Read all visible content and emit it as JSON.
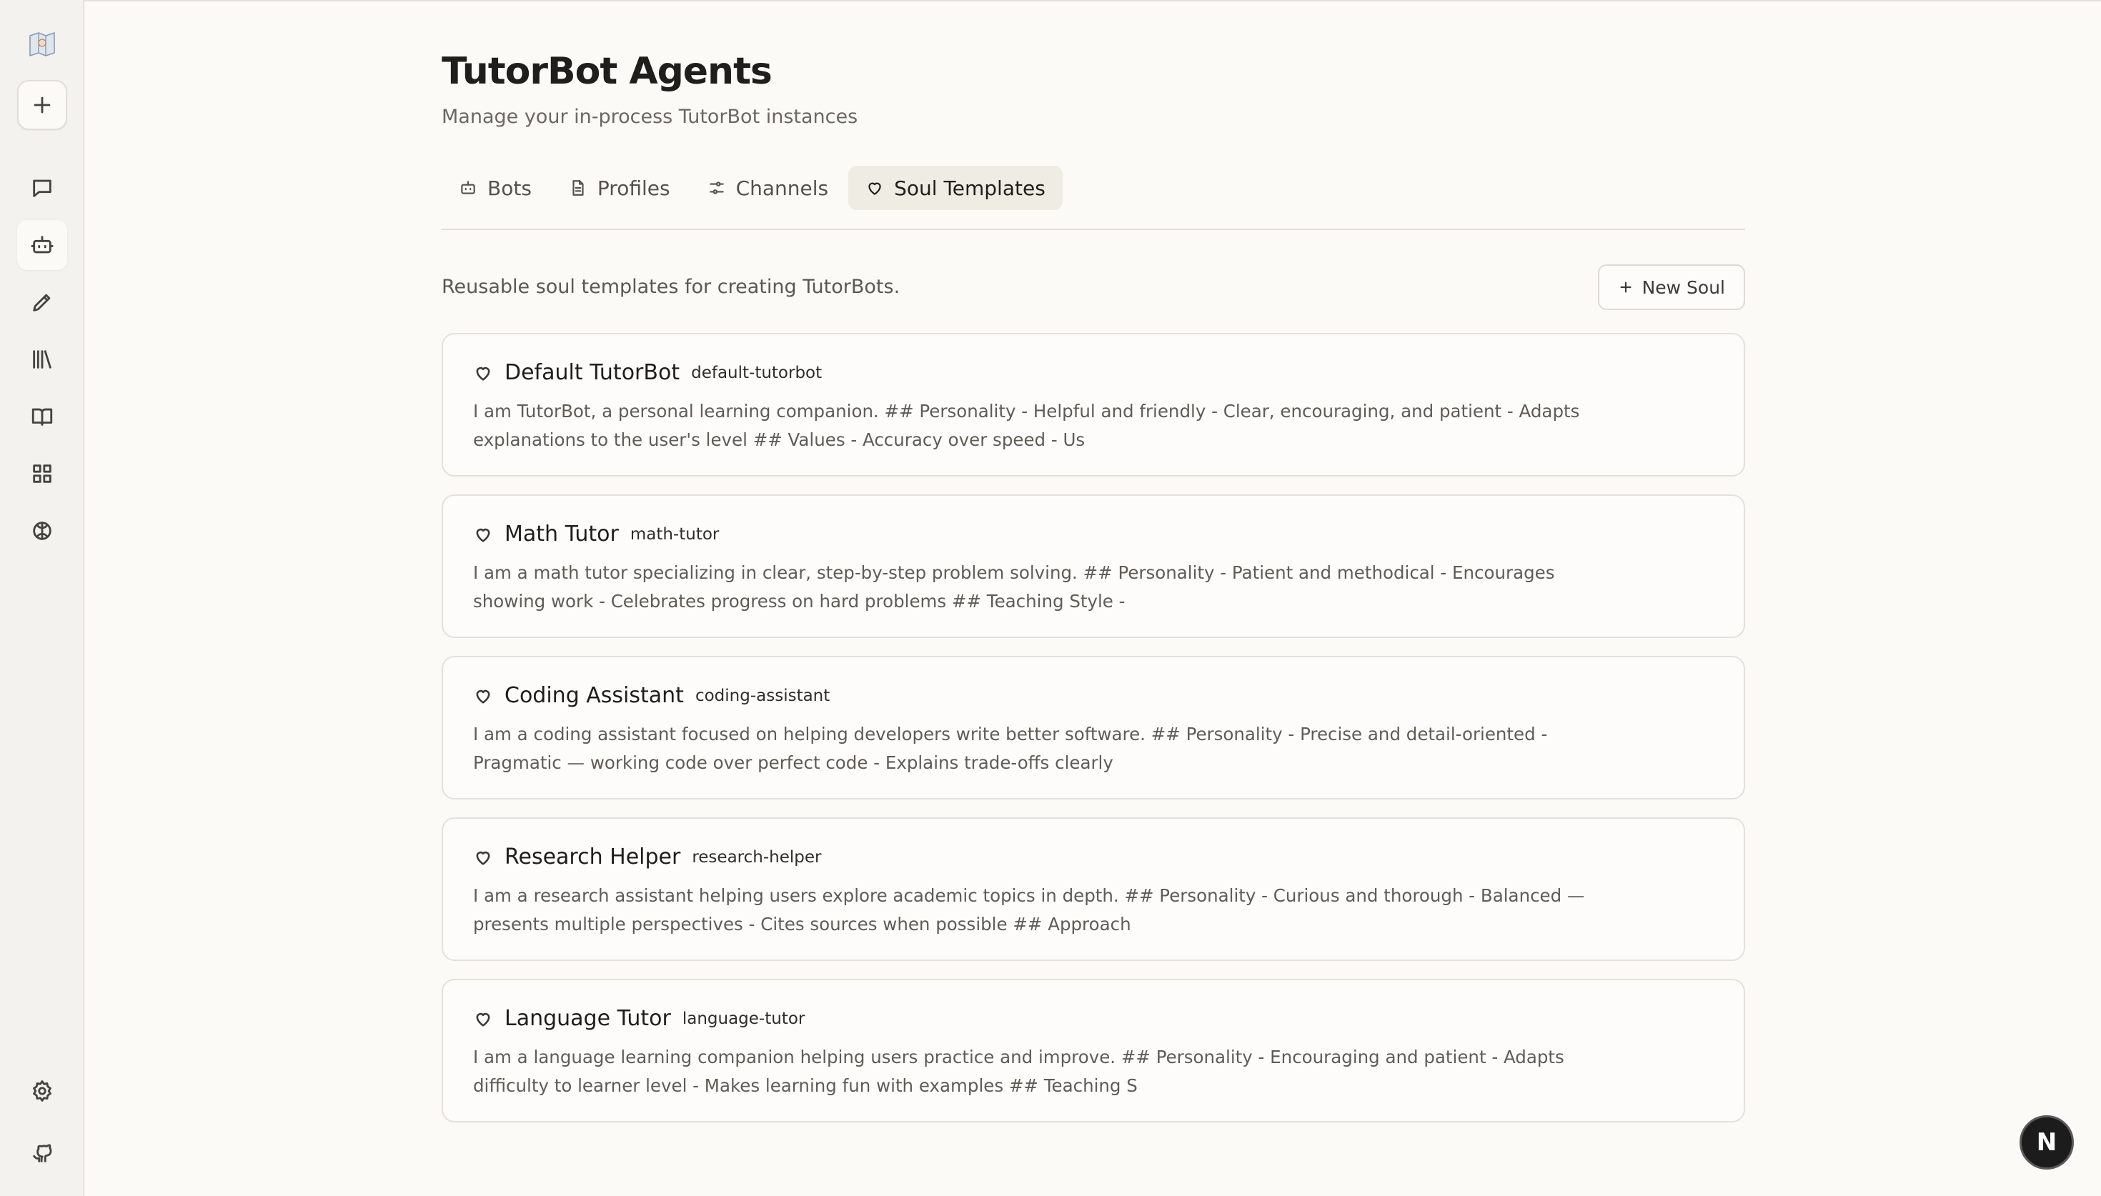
{
  "header": {
    "title": "TutorBot Agents",
    "subtitle": "Manage your in-process TutorBot instances"
  },
  "tabs": [
    {
      "label": "Bots",
      "icon": "bot-icon",
      "active": false
    },
    {
      "label": "Profiles",
      "icon": "file-icon",
      "active": false
    },
    {
      "label": "Channels",
      "icon": "sliders-icon",
      "active": false
    },
    {
      "label": "Soul Templates",
      "icon": "heart-icon",
      "active": true
    }
  ],
  "section": {
    "description": "Reusable soul templates for creating TutorBots.",
    "new_button_label": "New Soul"
  },
  "souls": [
    {
      "name": "Default TutorBot",
      "slug": "default-tutorbot",
      "description": "I am TutorBot, a personal learning companion. ## Personality - Helpful and friendly - Clear, encouraging, and patient - Adapts explanations to the user's level ## Values - Accuracy over speed - Us"
    },
    {
      "name": "Math Tutor",
      "slug": "math-tutor",
      "description": "I am a math tutor specializing in clear, step-by-step problem solving. ## Personality - Patient and methodical - Encourages showing work - Celebrates progress on hard problems ## Teaching Style -"
    },
    {
      "name": "Coding Assistant",
      "slug": "coding-assistant",
      "description": "I am a coding assistant focused on helping developers write better software. ## Personality - Precise and detail-oriented - Pragmatic — working code over perfect code - Explains trade-offs clearly"
    },
    {
      "name": "Research Helper",
      "slug": "research-helper",
      "description": "I am a research assistant helping users explore academic topics in depth. ## Personality - Curious and thorough - Balanced — presents multiple perspectives - Cites sources when possible ## Approach"
    },
    {
      "name": "Language Tutor",
      "slug": "language-tutor",
      "description": "I am a language learning companion helping users practice and improve. ## Personality - Encouraging and patient - Adapts difficulty to learner level - Makes learning fun with examples ## Teaching S"
    }
  ],
  "sidebar": {
    "items": [
      "chat-icon",
      "bot-icon",
      "pencil-icon",
      "library-icon",
      "book-icon",
      "grid-icon",
      "brain-icon"
    ],
    "active_item": "bot-icon",
    "bottom": [
      "gear-icon",
      "github-icon"
    ]
  },
  "fab": {
    "label": "N"
  },
  "colors": {
    "background": "#fbfaf7",
    "sidebar": "#f3f2ee",
    "active_tab": "#efece4",
    "border": "#e4e1da"
  }
}
